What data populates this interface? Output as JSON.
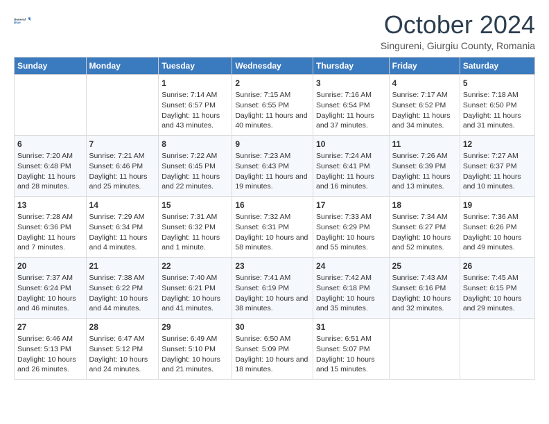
{
  "logo": {
    "line1": "General",
    "line2": "Blue"
  },
  "title": "October 2024",
  "location": "Singureni, Giurgiu County, Romania",
  "columns": [
    "Sunday",
    "Monday",
    "Tuesday",
    "Wednesday",
    "Thursday",
    "Friday",
    "Saturday"
  ],
  "weeks": [
    [
      {
        "day": "",
        "content": ""
      },
      {
        "day": "",
        "content": ""
      },
      {
        "day": "1",
        "content": "Sunrise: 7:14 AM\nSunset: 6:57 PM\nDaylight: 11 hours and 43 minutes."
      },
      {
        "day": "2",
        "content": "Sunrise: 7:15 AM\nSunset: 6:55 PM\nDaylight: 11 hours and 40 minutes."
      },
      {
        "day": "3",
        "content": "Sunrise: 7:16 AM\nSunset: 6:54 PM\nDaylight: 11 hours and 37 minutes."
      },
      {
        "day": "4",
        "content": "Sunrise: 7:17 AM\nSunset: 6:52 PM\nDaylight: 11 hours and 34 minutes."
      },
      {
        "day": "5",
        "content": "Sunrise: 7:18 AM\nSunset: 6:50 PM\nDaylight: 11 hours and 31 minutes."
      }
    ],
    [
      {
        "day": "6",
        "content": "Sunrise: 7:20 AM\nSunset: 6:48 PM\nDaylight: 11 hours and 28 minutes."
      },
      {
        "day": "7",
        "content": "Sunrise: 7:21 AM\nSunset: 6:46 PM\nDaylight: 11 hours and 25 minutes."
      },
      {
        "day": "8",
        "content": "Sunrise: 7:22 AM\nSunset: 6:45 PM\nDaylight: 11 hours and 22 minutes."
      },
      {
        "day": "9",
        "content": "Sunrise: 7:23 AM\nSunset: 6:43 PM\nDaylight: 11 hours and 19 minutes."
      },
      {
        "day": "10",
        "content": "Sunrise: 7:24 AM\nSunset: 6:41 PM\nDaylight: 11 hours and 16 minutes."
      },
      {
        "day": "11",
        "content": "Sunrise: 7:26 AM\nSunset: 6:39 PM\nDaylight: 11 hours and 13 minutes."
      },
      {
        "day": "12",
        "content": "Sunrise: 7:27 AM\nSunset: 6:37 PM\nDaylight: 11 hours and 10 minutes."
      }
    ],
    [
      {
        "day": "13",
        "content": "Sunrise: 7:28 AM\nSunset: 6:36 PM\nDaylight: 11 hours and 7 minutes."
      },
      {
        "day": "14",
        "content": "Sunrise: 7:29 AM\nSunset: 6:34 PM\nDaylight: 11 hours and 4 minutes."
      },
      {
        "day": "15",
        "content": "Sunrise: 7:31 AM\nSunset: 6:32 PM\nDaylight: 11 hours and 1 minute."
      },
      {
        "day": "16",
        "content": "Sunrise: 7:32 AM\nSunset: 6:31 PM\nDaylight: 10 hours and 58 minutes."
      },
      {
        "day": "17",
        "content": "Sunrise: 7:33 AM\nSunset: 6:29 PM\nDaylight: 10 hours and 55 minutes."
      },
      {
        "day": "18",
        "content": "Sunrise: 7:34 AM\nSunset: 6:27 PM\nDaylight: 10 hours and 52 minutes."
      },
      {
        "day": "19",
        "content": "Sunrise: 7:36 AM\nSunset: 6:26 PM\nDaylight: 10 hours and 49 minutes."
      }
    ],
    [
      {
        "day": "20",
        "content": "Sunrise: 7:37 AM\nSunset: 6:24 PM\nDaylight: 10 hours and 46 minutes."
      },
      {
        "day": "21",
        "content": "Sunrise: 7:38 AM\nSunset: 6:22 PM\nDaylight: 10 hours and 44 minutes."
      },
      {
        "day": "22",
        "content": "Sunrise: 7:40 AM\nSunset: 6:21 PM\nDaylight: 10 hours and 41 minutes."
      },
      {
        "day": "23",
        "content": "Sunrise: 7:41 AM\nSunset: 6:19 PM\nDaylight: 10 hours and 38 minutes."
      },
      {
        "day": "24",
        "content": "Sunrise: 7:42 AM\nSunset: 6:18 PM\nDaylight: 10 hours and 35 minutes."
      },
      {
        "day": "25",
        "content": "Sunrise: 7:43 AM\nSunset: 6:16 PM\nDaylight: 10 hours and 32 minutes."
      },
      {
        "day": "26",
        "content": "Sunrise: 7:45 AM\nSunset: 6:15 PM\nDaylight: 10 hours and 29 minutes."
      }
    ],
    [
      {
        "day": "27",
        "content": "Sunrise: 6:46 AM\nSunset: 5:13 PM\nDaylight: 10 hours and 26 minutes."
      },
      {
        "day": "28",
        "content": "Sunrise: 6:47 AM\nSunset: 5:12 PM\nDaylight: 10 hours and 24 minutes."
      },
      {
        "day": "29",
        "content": "Sunrise: 6:49 AM\nSunset: 5:10 PM\nDaylight: 10 hours and 21 minutes."
      },
      {
        "day": "30",
        "content": "Sunrise: 6:50 AM\nSunset: 5:09 PM\nDaylight: 10 hours and 18 minutes."
      },
      {
        "day": "31",
        "content": "Sunrise: 6:51 AM\nSunset: 5:07 PM\nDaylight: 10 hours and 15 minutes."
      },
      {
        "day": "",
        "content": ""
      },
      {
        "day": "",
        "content": ""
      }
    ]
  ]
}
